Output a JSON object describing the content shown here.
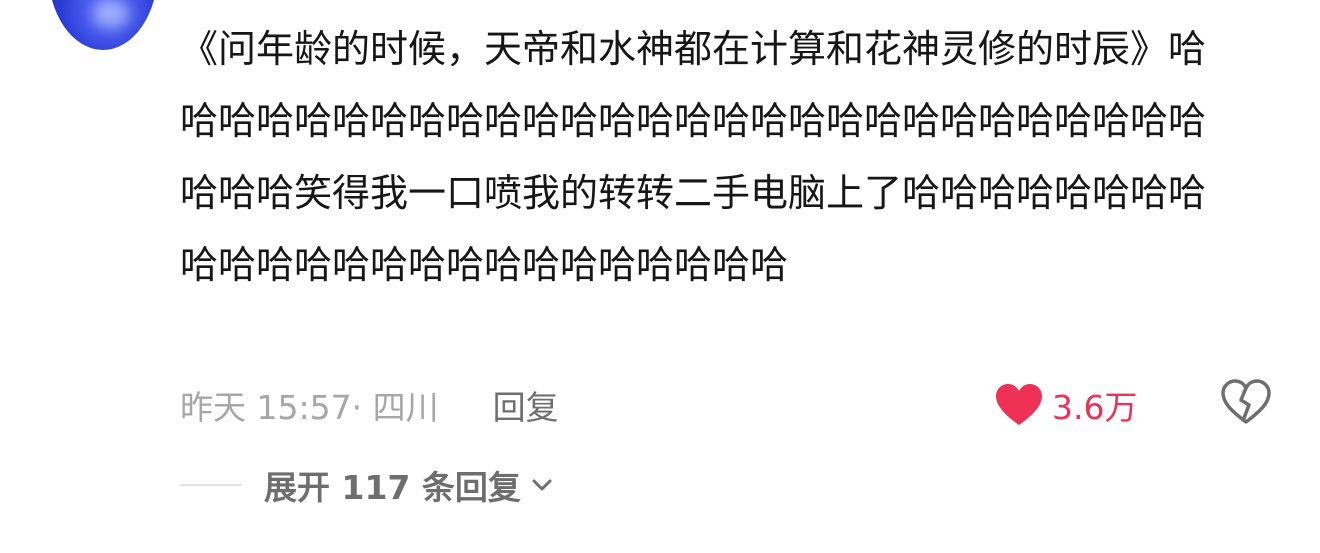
{
  "comment": {
    "text": "《问年龄的时候，天帝和水神都在计算和花神灵修的时辰》哈哈哈哈哈哈哈哈哈哈哈哈哈哈哈哈哈哈哈哈哈哈哈哈哈哈哈哈哈哈哈笑得我一口喷我的转转二手电脑上了哈哈哈哈哈哈哈哈哈哈哈哈哈哈哈哈哈哈哈哈哈哈哈哈",
    "timestamp": "昨天 15:57",
    "location": "· 四川",
    "reply_label": "回复",
    "like_count": "3.6万",
    "expand_label": "展开 117 条回复"
  },
  "icons": {
    "avatar": "user-avatar",
    "like": "heart-icon",
    "dislike": "broken-heart-icon",
    "expand": "chevron-down-icon"
  },
  "colors": {
    "like": "#ee3155",
    "muted_text": "#a7a7a7",
    "secondary_text": "#6e6e6e",
    "primary_text": "#161616"
  }
}
